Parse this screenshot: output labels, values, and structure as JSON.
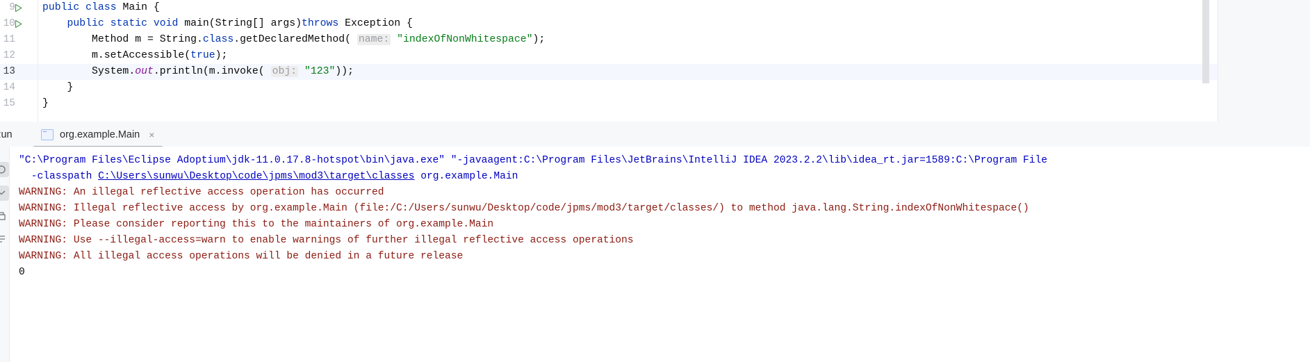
{
  "editor": {
    "lines": [
      {
        "number": "9",
        "has_run_arrow": true,
        "current": false,
        "tokens": [
          {
            "t": "public ",
            "c": "kw"
          },
          {
            "t": "class ",
            "c": "kw"
          },
          {
            "t": "Main {",
            "c": ""
          }
        ]
      },
      {
        "number": "10",
        "has_run_arrow": true,
        "current": false,
        "tokens": [
          {
            "t": "    ",
            "c": ""
          },
          {
            "t": "public ",
            "c": "kw"
          },
          {
            "t": "static ",
            "c": "kw"
          },
          {
            "t": "void ",
            "c": "kw"
          },
          {
            "t": "main(String[] args)",
            "c": ""
          },
          {
            "t": "throws ",
            "c": "kw"
          },
          {
            "t": "Exception {",
            "c": ""
          }
        ]
      },
      {
        "number": "11",
        "has_run_arrow": false,
        "current": false,
        "tokens": [
          {
            "t": "        Method m = String.",
            "c": ""
          },
          {
            "t": "class",
            "c": "kw"
          },
          {
            "t": ".getDeclaredMethod( ",
            "c": ""
          },
          {
            "t": "name:",
            "c": "hint"
          },
          {
            "t": " ",
            "c": ""
          },
          {
            "t": "\"indexOfNonWhitespace\"",
            "c": "str"
          },
          {
            "t": ");",
            "c": ""
          }
        ]
      },
      {
        "number": "12",
        "has_run_arrow": false,
        "current": false,
        "tokens": [
          {
            "t": "        m.setAccessible(",
            "c": ""
          },
          {
            "t": "true",
            "c": "kw"
          },
          {
            "t": ");",
            "c": ""
          }
        ]
      },
      {
        "number": "13",
        "has_run_arrow": false,
        "current": true,
        "tokens": [
          {
            "t": "        System.",
            "c": ""
          },
          {
            "t": "out",
            "c": "fld"
          },
          {
            "t": ".println(m.invoke( ",
            "c": ""
          },
          {
            "t": "obj:",
            "c": "hint"
          },
          {
            "t": " ",
            "c": ""
          },
          {
            "t": "\"123\"",
            "c": "str"
          },
          {
            "t": "));",
            "c": ""
          }
        ]
      },
      {
        "number": "14",
        "has_run_arrow": false,
        "current": false,
        "tokens": [
          {
            "t": "    }",
            "c": ""
          }
        ]
      },
      {
        "number": "15",
        "has_run_arrow": false,
        "current": false,
        "tokens": [
          {
            "t": "}",
            "c": ""
          }
        ]
      }
    ]
  },
  "tool_window": {
    "title": "Run",
    "tab": {
      "label": "org.example.Main",
      "icon": "run-configuration-icon",
      "close_label": "×"
    },
    "toolbar": {
      "stop_label": "stop-icon",
      "profiler_label": "profiler-icon",
      "more_label": "more-options-icon"
    }
  },
  "console": {
    "lines": [
      {
        "kind": "cmd",
        "indent": 0,
        "text": "\"C:\\Program Files\\Eclipse Adoptium\\jdk-11.0.17.8-hotspot\\bin\\java.exe\" \"-javaagent:C:\\Program Files\\JetBrains\\IntelliJ IDEA 2023.2.2\\lib\\idea_rt.jar=1589:C:\\Program File"
      },
      {
        "kind": "cmd",
        "indent": 1,
        "prefix": " -classpath ",
        "link": "C:\\Users\\sunwu\\Desktop\\code\\jpms\\mod3\\target\\classes",
        "suffix": " org.example.Main"
      },
      {
        "kind": "warn",
        "indent": 0,
        "text": "WARNING: An illegal reflective access operation has occurred"
      },
      {
        "kind": "warn",
        "indent": 0,
        "text": "WARNING: Illegal reflective access by org.example.Main (file:/C:/Users/sunwu/Desktop/code/jpms/mod3/target/classes/) to method java.lang.String.indexOfNonWhitespace()"
      },
      {
        "kind": "warn",
        "indent": 0,
        "text": "WARNING: Please consider reporting this to the maintainers of org.example.Main"
      },
      {
        "kind": "warn",
        "indent": 0,
        "text": "WARNING: Use --illegal-access=warn to enable warnings of further illegal reflective access operations"
      },
      {
        "kind": "warn",
        "indent": 0,
        "text": "WARNING: All illegal access operations will be denied in a future release"
      },
      {
        "kind": "out",
        "indent": 0,
        "text": "0"
      }
    ]
  },
  "colors": {
    "keyword": "#0033b3",
    "string": "#067d17",
    "field": "#871094",
    "warning": "#8b1a10",
    "command": "#0000c0",
    "hint_bg": "#ededee",
    "current_line_bg": "#f4f7fe",
    "panel_bg": "#f7f8fa"
  }
}
